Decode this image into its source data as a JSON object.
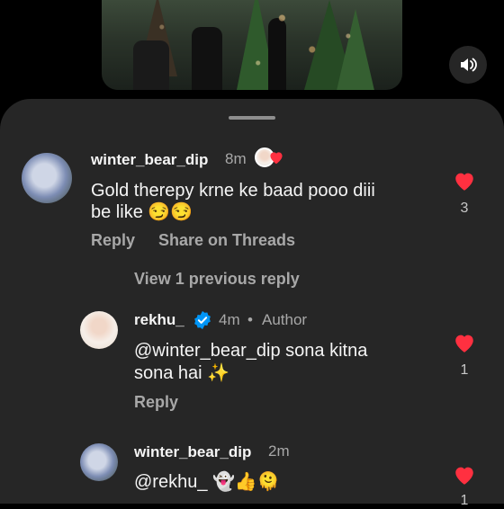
{
  "video": {
    "mute_icon": "speaker-icon"
  },
  "comments": [
    {
      "username": "winter_bear_dip",
      "time": "8m",
      "text_line1": "Gold therepy krne ke baad pooo diii",
      "text_line2": "be like 😏😏",
      "reply_label": "Reply",
      "share_label": "Share on Threads",
      "like_count": "3"
    }
  ],
  "view_previous": "View 1 previous reply",
  "replies": [
    {
      "username": "rekhu_",
      "time": "4m",
      "separator": "•",
      "author_label": "Author",
      "mention": "@winter_bear_dip",
      "text_after_mention": " sona kitna",
      "text_line2": "sona hai ✨",
      "reply_label": "Reply",
      "like_count": "1"
    },
    {
      "username": "winter_bear_dip",
      "time": "2m",
      "mention": "@rekhu_",
      "text_after_mention": " 👻👍🫠",
      "like_count": "1"
    }
  ],
  "colors": {
    "like_red": "#ff3040",
    "verified_blue": "#0095f6",
    "sheet_bg": "#262626"
  }
}
